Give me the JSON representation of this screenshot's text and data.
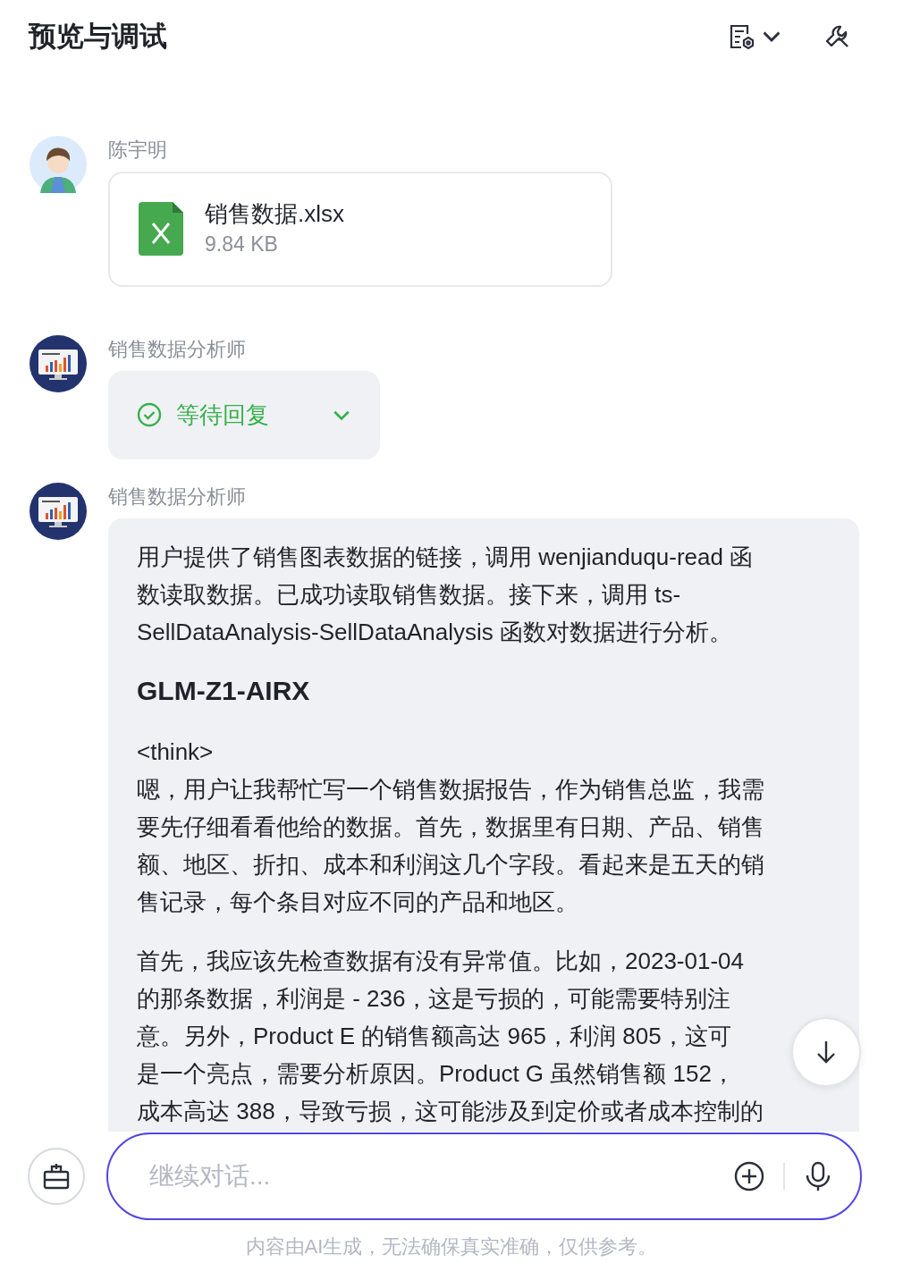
{
  "header": {
    "title": "预览与调试"
  },
  "messages": [
    {
      "kind": "file",
      "sender": "陈宇明",
      "file": {
        "name": "销售数据.xlsx",
        "size": "9.84 KB"
      }
    },
    {
      "kind": "status",
      "sender": "销售数据分析师",
      "status": {
        "label": "等待回复",
        "expanded": false
      }
    },
    {
      "kind": "text",
      "sender": "销售数据分析师",
      "blocks": [
        {
          "kind": "paragraph",
          "lines": [
            "用户提供了销售图表数据的链接，调用 wenjianduqu-read 函",
            "数读取数据。已成功读取销售数据。接下来，调用 ts-",
            "SellDataAnalysis-SellDataAnalysis 函数对数据进行分析。"
          ]
        },
        {
          "kind": "heading",
          "text": "GLM-Z1-AIRX"
        },
        {
          "kind": "paragraph",
          "lines": [
            "<think>",
            "嗯，用户让我帮忙写一个销售数据报告，作为销售总监，我需",
            "要先仔细看看他给的数据。首先，数据里有日期、产品、销售",
            "额、地区、折扣、成本和利润这几个字段。看起来是五天的销",
            "售记录，每个条目对应不同的产品和地区。"
          ]
        },
        {
          "kind": "paragraph",
          "lines": [
            "首先，我应该先检查数据有没有异常值。比如，2023-01-04",
            "的那条数据，利润是 - 236，这是亏损的，可能需要特别注",
            "意。另外，Product E 的销售额高达 965，利润 805，这可",
            "是一个亮点，需要分析原因。Product G 虽然销售额 152，",
            "成本高达 388，导致亏损，这可能涉及到定价或者成本控制的"
          ]
        }
      ]
    }
  ],
  "input": {
    "placeholder": "继续对话..."
  },
  "disclaimer": "内容由AI生成，无法确保真实准确，仅供参考。"
}
